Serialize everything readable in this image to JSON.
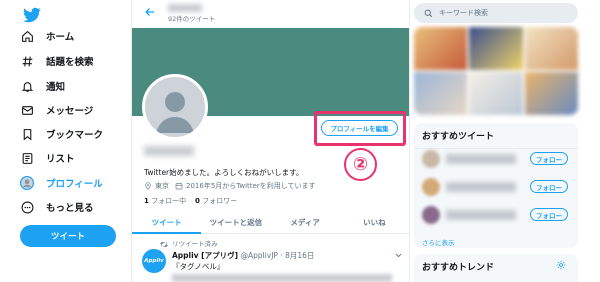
{
  "sidebar": {
    "items": [
      {
        "label": "ホーム",
        "icon": "home-icon"
      },
      {
        "label": "話題を検索",
        "icon": "hashtag-icon"
      },
      {
        "label": "通知",
        "icon": "bell-icon"
      },
      {
        "label": "メッセージ",
        "icon": "mail-icon"
      },
      {
        "label": "ブックマーク",
        "icon": "bookmark-icon"
      },
      {
        "label": "リスト",
        "icon": "list-icon"
      },
      {
        "label": "プロフィール",
        "icon": "profile-icon"
      },
      {
        "label": "もっと見る",
        "icon": "more-icon"
      }
    ],
    "tweet_button": "ツイート"
  },
  "profile": {
    "tweet_count": "92件のツイート",
    "edit_button": "プロフィールを編集",
    "step_marker": "②",
    "bio": "Twitter始めました。よろしくおねがいします。",
    "location": "東京",
    "joined": "2016年5月からTwitterを利用しています",
    "following_count": "1",
    "following_label": "フォロー中",
    "followers_count": "0",
    "followers_label": "フォロワー"
  },
  "tabs": [
    "ツイート",
    "ツイートと返信",
    "メディア",
    "いいね"
  ],
  "tweet": {
    "retweet_label": "リツイート済み",
    "avatar_text": "Appliv",
    "author": "Appliv [アプリヴ]",
    "handle": "@ApplivJP",
    "date": "· 8月16日",
    "text": "『タグノベル』"
  },
  "right": {
    "search_placeholder": "キーワード検索",
    "recommended_title": "おすすめツイート",
    "follow_label": "フォロー",
    "show_more": "さらに表示",
    "trends_title": "おすすめトレンド"
  },
  "colors": {
    "accent": "#1da1f2",
    "banner": "#4a8a7f",
    "highlight": "#e8336d"
  }
}
